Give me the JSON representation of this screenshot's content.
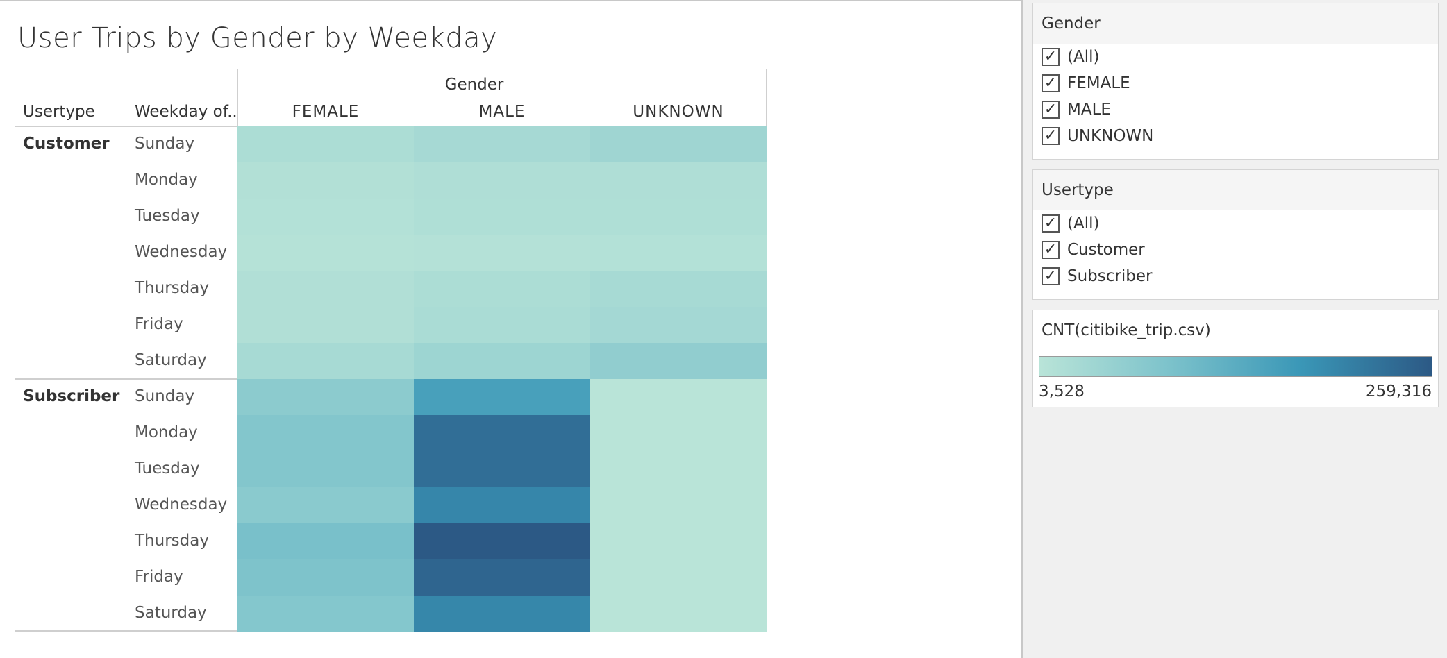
{
  "chart_data": {
    "type": "heatmap",
    "title": "User Trips by Gender by Weekday",
    "row_headers": [
      "Usertype",
      "Weekday of.."
    ],
    "column_group_label": "Gender",
    "columns": [
      "FEMALE",
      "MALE",
      "UNKNOWN"
    ],
    "weekdays": [
      "Sunday",
      "Monday",
      "Tuesday",
      "Wednesday",
      "Thursday",
      "Friday",
      "Saturday"
    ],
    "groups": [
      {
        "usertype": "Customer",
        "values": [
          [
            22000,
            30000,
            40000
          ],
          [
            14000,
            18000,
            18000
          ],
          [
            12000,
            17000,
            17000
          ],
          [
            9000,
            11000,
            12000
          ],
          [
            15000,
            22000,
            28000
          ],
          [
            15000,
            24000,
            33000
          ],
          [
            28000,
            42000,
            60000
          ]
        ]
      },
      {
        "usertype": "Subscriber",
        "values": [
          [
            66000,
            156000,
            3600
          ],
          [
            79000,
            230000,
            3600
          ],
          [
            79000,
            230000,
            3600
          ],
          [
            69000,
            197000,
            3600
          ],
          [
            93000,
            259000,
            3600
          ],
          [
            86000,
            243000,
            3600
          ],
          [
            77000,
            196000,
            3600
          ]
        ]
      }
    ],
    "color_scale": {
      "label": "CNT(citibike_trip.csv)",
      "min": 3528,
      "max": 259316,
      "min_label": "3,528",
      "max_label": "259,316",
      "stops": [
        "#b9e4d8",
        "#7cc2cb",
        "#3a97b7",
        "#2c5985"
      ]
    }
  },
  "filters": {
    "gender": {
      "title": "Gender",
      "options": [
        {
          "label": "(All)",
          "checked": true
        },
        {
          "label": "FEMALE",
          "checked": true
        },
        {
          "label": "MALE",
          "checked": true
        },
        {
          "label": "UNKNOWN",
          "checked": true
        }
      ]
    },
    "usertype": {
      "title": "Usertype",
      "options": [
        {
          "label": "(All)",
          "checked": true
        },
        {
          "label": "Customer",
          "checked": true
        },
        {
          "label": "Subscriber",
          "checked": true
        }
      ]
    }
  }
}
